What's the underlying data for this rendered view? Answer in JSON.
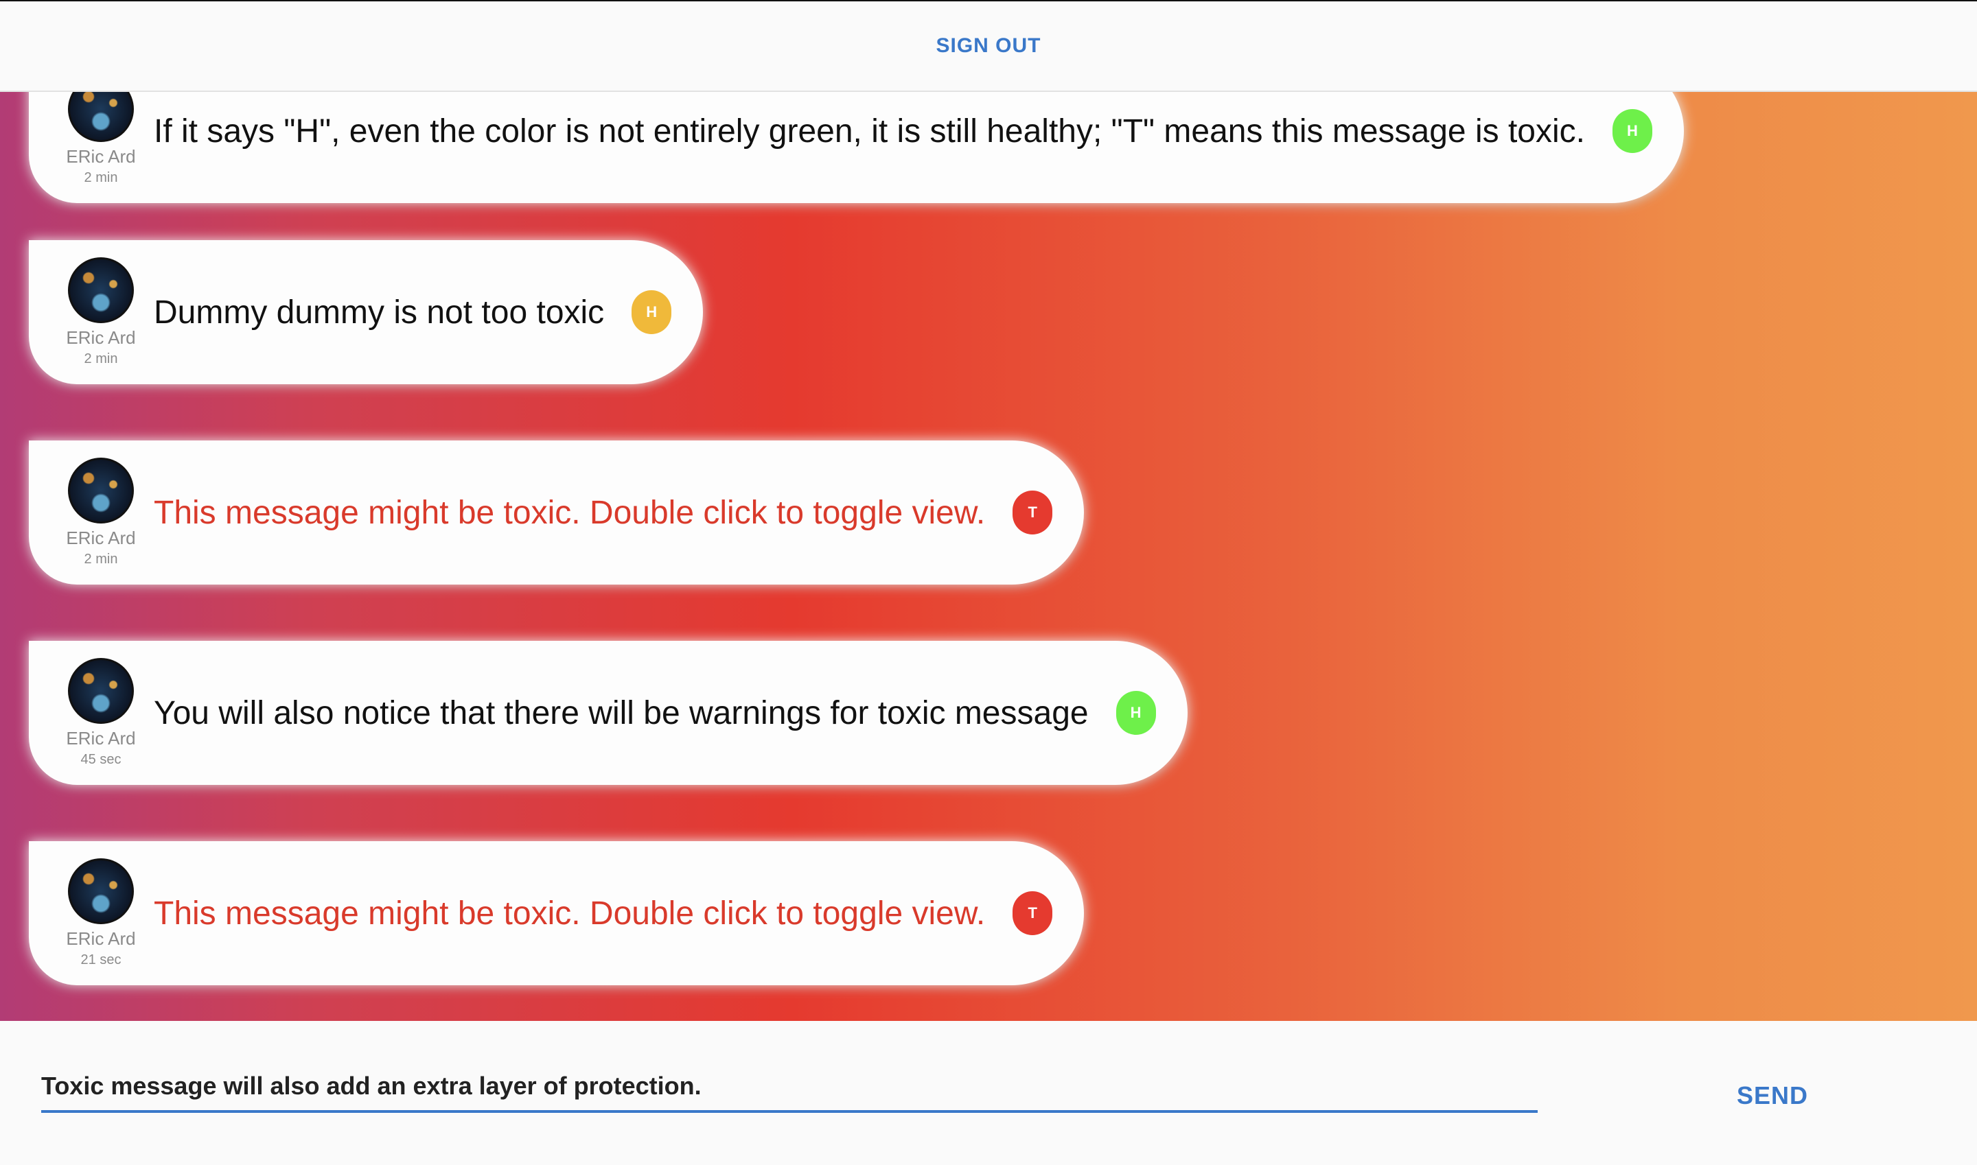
{
  "header": {
    "sign_out_label": "SIGN OUT"
  },
  "messages": [
    {
      "author": "ERic Ard",
      "time": "2 min",
      "text": "If it says \"H\", even the color is not entirely green, it is still healthy; \"T\" means this message is toxic.",
      "toxic": false,
      "badge": "H",
      "badge_color": "#6ef04a"
    },
    {
      "author": "ERic Ard",
      "time": "2 min",
      "text": "Dummy dummy is not too toxic",
      "toxic": false,
      "badge": "H",
      "badge_color": "#f0b93a"
    },
    {
      "author": "ERic Ard",
      "time": "2 min",
      "text": "This message might be toxic. Double click to toggle view.",
      "toxic": true,
      "badge": "T",
      "badge_color": "#e53a2f"
    },
    {
      "author": "ERic Ard",
      "time": "45 sec",
      "text": "You will also notice that there will be warnings for toxic message",
      "toxic": false,
      "badge": "H",
      "badge_color": "#6ef04a"
    },
    {
      "author": "ERic Ard",
      "time": "21 sec",
      "text": "This message might be toxic. Double click to toggle view.",
      "toxic": true,
      "badge": "T",
      "badge_color": "#e53a2f"
    }
  ],
  "composer": {
    "value": "Toxic message will also add an extra layer of protection.",
    "send_label": "SEND"
  },
  "colors": {
    "accent": "#3a78c9",
    "toxic_text": "#d93a2b"
  }
}
